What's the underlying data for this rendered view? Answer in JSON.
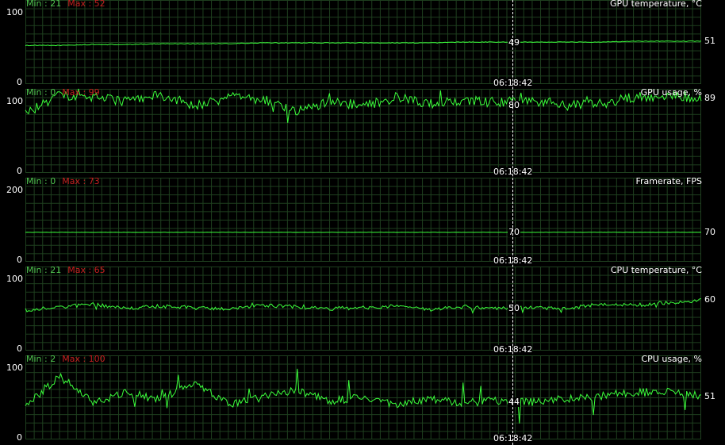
{
  "cursor_time": "06:18:42",
  "colors": {
    "line": "#3bff3b",
    "grid": "#1f401f",
    "min": "#4ec24e",
    "max": "#c42020",
    "background": "#000000"
  },
  "graphs": [
    {
      "title": "GPU temperature, °C",
      "min_label": "Min : 21",
      "max_label": "Max : 52",
      "y_max": "100",
      "y_min": "0",
      "cursor_value": "49",
      "current_value": "51",
      "timestamp": "06:18:42"
    },
    {
      "title": "GPU usage, %",
      "min_label": "Min : 0",
      "max_label": "Max : 99",
      "y_max": "100",
      "y_min": "0",
      "cursor_value": "80",
      "current_value": "89",
      "timestamp": "06:18:42"
    },
    {
      "title": "Framerate, FPS",
      "min_label": "Min : 0",
      "max_label": "Max : 73",
      "y_max": "200",
      "y_min": "0",
      "cursor_value": "70",
      "current_value": "70",
      "timestamp": "06:18:42"
    },
    {
      "title": "CPU temperature, °C",
      "min_label": "Min : 21",
      "max_label": "Max : 65",
      "y_max": "100",
      "y_min": "0",
      "cursor_value": "50",
      "current_value": "60",
      "timestamp": "06:18:42"
    },
    {
      "title": "CPU usage, %",
      "min_label": "Min : 2",
      "max_label": "Max : 100",
      "y_max": "100",
      "y_min": "0",
      "cursor_value": "44",
      "current_value": "51",
      "timestamp": "06:18:42"
    }
  ],
  "chart_data": [
    {
      "type": "line",
      "title": "GPU temperature, °C",
      "ylim": [
        0,
        100
      ],
      "series": [
        {
          "values": [
            46,
            46,
            47,
            47,
            48,
            48,
            48,
            49,
            49,
            49,
            49,
            49,
            49,
            50,
            50,
            50,
            50,
            50,
            51,
            51,
            51
          ]
        }
      ]
    },
    {
      "type": "line",
      "title": "GPU usage, %",
      "ylim": [
        0,
        100
      ],
      "series": [
        {
          "values": [
            70,
            92,
            90,
            85,
            93,
            80,
            90,
            88,
            72,
            85,
            80,
            90,
            82,
            86,
            84,
            88,
            80,
            82,
            90,
            92,
            89
          ]
        }
      ]
    },
    {
      "type": "line",
      "title": "Framerate, FPS",
      "ylim": [
        0,
        200
      ],
      "series": [
        {
          "values": [
            70,
            70,
            70,
            70,
            70,
            70,
            70,
            70,
            70,
            70,
            70,
            70,
            70,
            70,
            70,
            70,
            70,
            70,
            70,
            70,
            70
          ]
        }
      ]
    },
    {
      "type": "line",
      "title": "CPU temperature, °C",
      "ylim": [
        0,
        100
      ],
      "series": [
        {
          "values": [
            48,
            52,
            55,
            50,
            53,
            51,
            49,
            54,
            52,
            50,
            51,
            53,
            49,
            52,
            50,
            51,
            50,
            55,
            54,
            57,
            60
          ]
        }
      ]
    },
    {
      "type": "line",
      "title": "CPU usage, %",
      "ylim": [
        0,
        100
      ],
      "series": [
        {
          "values": [
            40,
            75,
            45,
            55,
            48,
            68,
            42,
            50,
            58,
            45,
            50,
            42,
            48,
            44,
            46,
            44,
            48,
            52,
            55,
            58,
            51
          ]
        }
      ]
    }
  ]
}
